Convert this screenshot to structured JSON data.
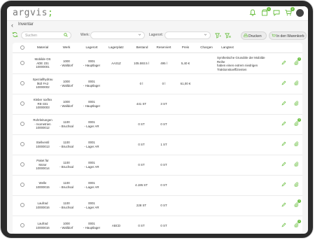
{
  "app": {
    "logo_main": "argvis",
    "logo_suffix": ";"
  },
  "header": {
    "icons": [
      "bell-icon",
      "box-icon",
      "chat-icon",
      "cart-icon",
      "avatar"
    ],
    "badges": {
      "box": "1",
      "cart": "2"
    }
  },
  "breadcrumb": {
    "back_glyph": "‹",
    "title": "Inventar"
  },
  "filters": {
    "search_placeholder": "Suchen",
    "werk_label": "Werk:",
    "werk_value": "",
    "lagerort_label": "Lagerort:",
    "lagerort_value": "",
    "print_label": "Drucken",
    "cart_label": "In den Warenkorb"
  },
  "table": {
    "columns": [
      "Material",
      "Werk",
      "Lagerort",
      "Lagerplatz",
      "Bestand",
      "Reserviert",
      "Preis",
      "Chargen",
      "Langtext"
    ],
    "rows": [
      {
        "material": [
          "Mobilde OS",
          "ADE 231",
          "10000001"
        ],
        "werk": [
          "1000",
          "- Walldorf"
        ],
        "lagerort": [
          "0001",
          "- Hauptlager"
        ],
        "lagerplatz": "AA31Z",
        "bestand": "105.593.5 l",
        "reserviert": "495 l",
        "preis": "5,40 €",
        "chargen": "",
        "langtext": [
          "Synthetische Grundöle der Mobilde Reihe",
          "haben einen extrem niedrigen",
          "Traktionskoeffizienten"
        ],
        "badge": "1"
      },
      {
        "material": [
          "Speziallhydrau",
          "likól FA2",
          "10000002"
        ],
        "werk": [
          "1000",
          "- Walldorf"
        ],
        "lagerort": [
          "0001",
          "- Hauptlager"
        ],
        "lagerplatz": "",
        "bestand": "0 l",
        "reserviert": "0 l",
        "preis": "61,00 €",
        "chargen": "",
        "langtext": [],
        "badge": ""
      },
      {
        "material": [
          "Kleber Ioxflex",
          "RE-331",
          "10000003"
        ],
        "werk": [
          "1000",
          "- Walldorf"
        ],
        "lagerort": [
          "0001",
          "- Hauptlager"
        ],
        "lagerplatz": "",
        "bestand": "441 ST",
        "reserviert": "3 ST",
        "preis": "",
        "chargen": "",
        "langtext": [],
        "badge": ""
      },
      {
        "material": [
          "Rohrleitungen",
          "- Isometrien",
          "10000012"
        ],
        "werk": [
          "1100",
          "- Bruchsal"
        ],
        "lagerort": [
          "0001",
          "- Lager AR"
        ],
        "lagerplatz": "",
        "bestand": "0 ST",
        "reserviert": "0 ST",
        "preis": "",
        "chargen": "",
        "langtext": [],
        "badge": "1"
      },
      {
        "material": [
          "Stellventil",
          "10000013"
        ],
        "werk": [
          "1100",
          "- Bruchsal"
        ],
        "lagerort": [
          "0001",
          "- Lager AR"
        ],
        "lagerplatz": "",
        "bestand": "0 ST",
        "reserviert": "1 ST",
        "preis": "",
        "chargen": "",
        "langtext": [],
        "badge": ""
      },
      {
        "material": [
          "Paket für",
          "Motor",
          "10000014"
        ],
        "werk": [
          "1100",
          "- Bruchsal"
        ],
        "lagerort": [
          "0001",
          "- Lager AR"
        ],
        "lagerplatz": "",
        "bestand": "0 ST",
        "reserviert": "0 ST",
        "preis": "",
        "chargen": "",
        "langtext": [],
        "badge": ""
      },
      {
        "material": [
          "Welle",
          "10000015"
        ],
        "werk": [
          "1100",
          "- Bruchsal"
        ],
        "lagerort": [
          "0001",
          "- Lager AR"
        ],
        "lagerplatz": "",
        "bestand": "4.195 ST",
        "reserviert": "0 ST",
        "preis": "",
        "chargen": "",
        "langtext": [],
        "badge": ""
      },
      {
        "material": [
          "Laufrad",
          "10000016"
        ],
        "werk": [
          "1100",
          "- Bruchsal"
        ],
        "lagerort": [
          "0001",
          "- Lager AR"
        ],
        "lagerplatz": "",
        "bestand": "228 ST",
        "reserviert": "0 ST",
        "preis": "",
        "chargen": "",
        "langtext": [],
        "badge": "1"
      },
      {
        "material": [
          "Laufrad",
          "10000016"
        ],
        "werk": [
          "1000",
          "- Walldorf"
        ],
        "lagerort": [
          "0001",
          "- Hauptlager"
        ],
        "lagerplatz": "ABCD",
        "bestand": "0 ST",
        "reserviert": "0 ST",
        "preis": "",
        "chargen": "",
        "langtext": [],
        "badge": "1"
      }
    ]
  },
  "colors": {
    "accent": "#6abf40",
    "background": "#f5f5f5",
    "text": "#333333"
  }
}
